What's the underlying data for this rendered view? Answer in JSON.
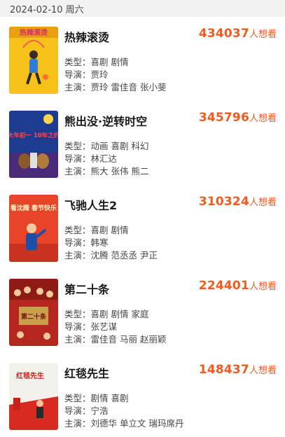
{
  "header": {
    "date": "2024-02-10 周六"
  },
  "labels": {
    "genre": "类型：",
    "director": "导演：",
    "cast": "主演：",
    "want_unit": "人想看"
  },
  "colors": {
    "accent": "#f25a1f",
    "header_bg": "#f2f2f2"
  },
  "movies": [
    {
      "title": "热辣滚烫",
      "want_count": "434037",
      "genre": "喜剧 剧情",
      "director": "贾玲",
      "cast": "贾玲 雷佳音 张小斐",
      "poster_text": "热辣滚烫"
    },
    {
      "title": "熊出没·逆转时空",
      "want_count": "345796",
      "genre": "动画 喜剧 科幻",
      "director": "林汇达",
      "cast": "熊大 张伟 熊二",
      "poster_text": "大年初一 10年之约"
    },
    {
      "title": "飞驰人生2",
      "want_count": "310324",
      "genre": "喜剧 剧情",
      "director": "韩寒",
      "cast": "沈腾 范丞丞 尹正",
      "poster_text": "看沈腾 春节快乐"
    },
    {
      "title": "第二十条",
      "want_count": "224401",
      "genre": "喜剧 剧情 家庭",
      "director": "张艺谋",
      "cast": "雷佳音 马丽 赵丽颖",
      "poster_text": "第二十条"
    },
    {
      "title": "红毯先生",
      "want_count": "148437",
      "genre": "剧情 喜剧",
      "director": "宁浩",
      "cast": "刘德华 单立文 瑞玛席丹",
      "poster_text": "红毯先生"
    }
  ]
}
